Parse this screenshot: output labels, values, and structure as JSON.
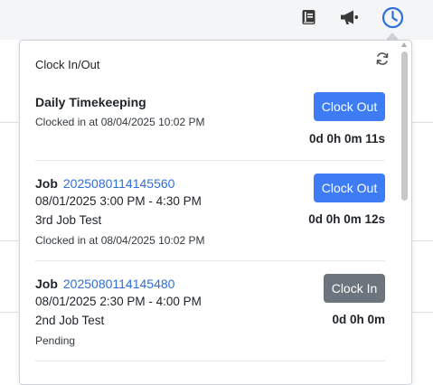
{
  "topbar": {
    "icons": [
      "book-icon",
      "megaphone-icon",
      "clock-icon"
    ],
    "active_color": "#2f6fdb",
    "icon_color": "#3a3a3a"
  },
  "panel": {
    "title": "Clock In/Out",
    "entries": [
      {
        "title": "Daily Timekeeping",
        "job_link": "",
        "date_range": "",
        "description": "",
        "status": "Clocked in at 08/04/2025 10:02 PM",
        "button_label": "Clock Out",
        "timer": "0d 0h 0m 11s"
      },
      {
        "title": "Job",
        "job_link": "2025080114145560",
        "date_range": "08/01/2025 3:00 PM - 4:30 PM",
        "description": "3rd Job Test",
        "status": "Clocked in at 08/04/2025 10:02 PM",
        "button_label": "Clock Out",
        "timer": "0d 0h 0m 12s"
      },
      {
        "title": "Job",
        "job_link": "2025080114145480",
        "date_range": "08/01/2025 2:30 PM - 4:00 PM",
        "description": "2nd Job Test",
        "status": "Pending",
        "button_label": "Clock In",
        "timer": "0d 0h 0m"
      }
    ]
  },
  "colors": {
    "primary_button": "#3d7cf5",
    "secondary_button": "#6c757d",
    "link": "#2f6fdb"
  }
}
